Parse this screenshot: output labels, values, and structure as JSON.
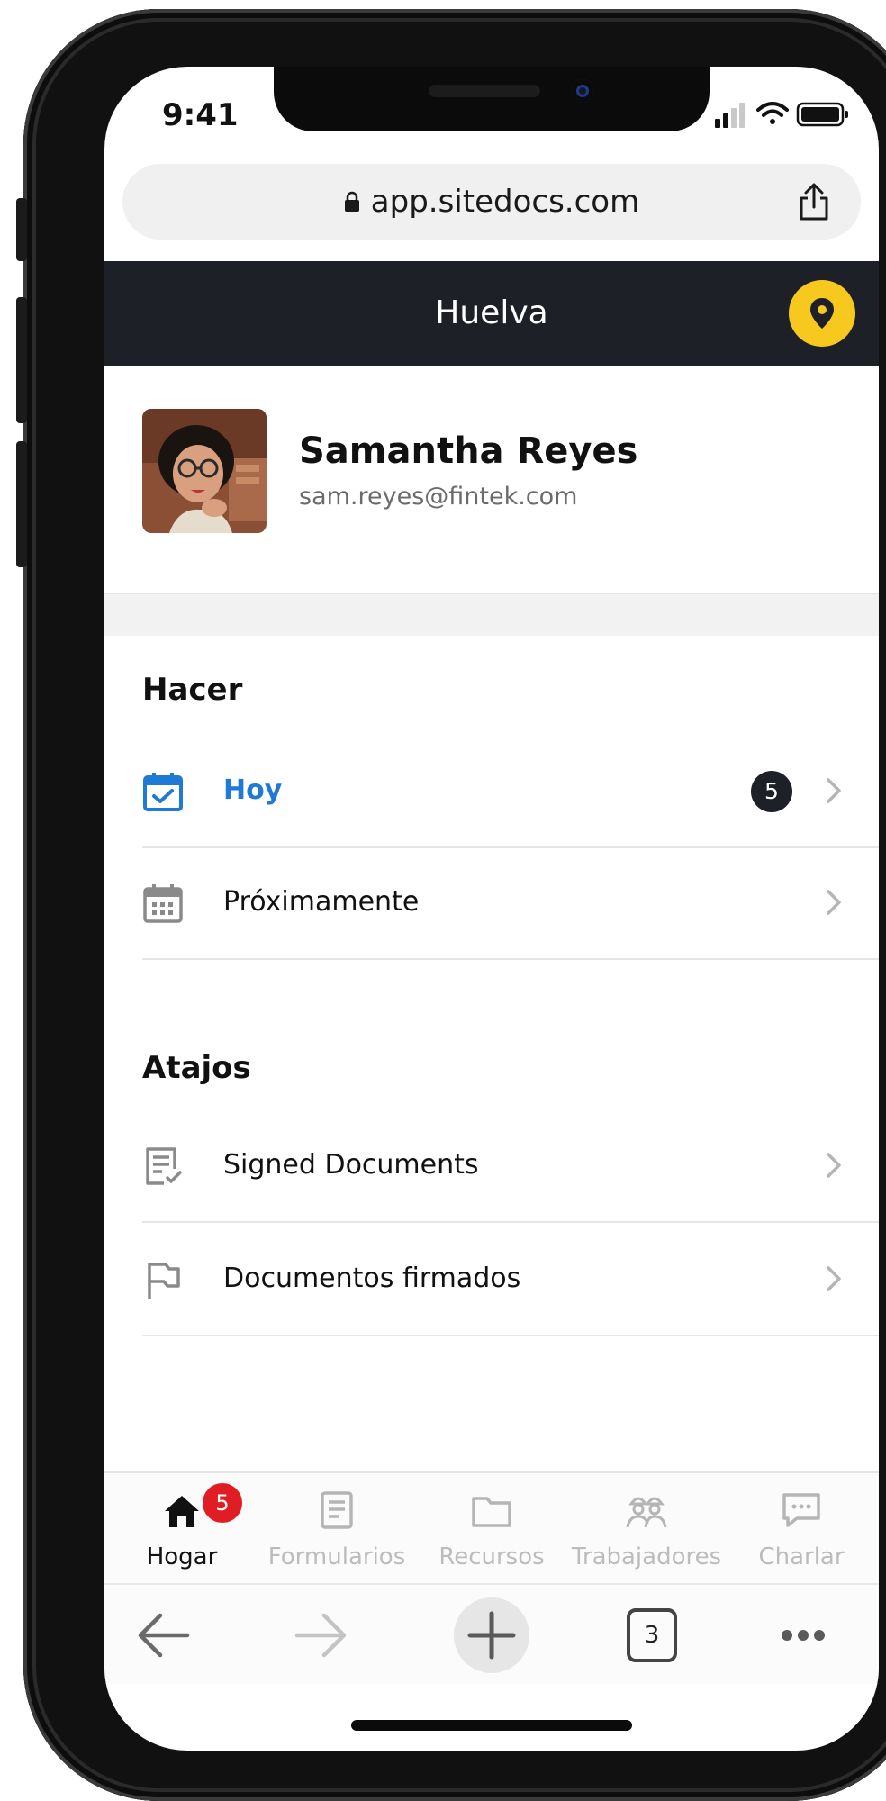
{
  "status_bar": {
    "time": "9:41"
  },
  "browser": {
    "url": "app.sitedocs.com",
    "tab_count": "3"
  },
  "header": {
    "title": "Huelva"
  },
  "profile": {
    "name": "Samantha Reyes",
    "email": "sam.reyes@fintek.com"
  },
  "sections": {
    "todo": {
      "title": "Hacer",
      "items": [
        {
          "label": "Hoy",
          "badge": "5",
          "icon": "calendar-check-icon",
          "color": "#1f7ad6"
        },
        {
          "label": "Próximamente",
          "icon": "calendar-grid-icon"
        }
      ]
    },
    "shortcuts": {
      "title": "Atajos",
      "items": [
        {
          "label": "Signed Documents",
          "icon": "signed-document-icon"
        },
        {
          "label": "Documentos firmados",
          "icon": "flag-icon"
        }
      ]
    }
  },
  "tab_bar": {
    "items": [
      {
        "label": "Hogar",
        "icon": "home-icon",
        "badge": "5",
        "active": true
      },
      {
        "label": "Formularios",
        "icon": "form-icon"
      },
      {
        "label": "Recursos",
        "icon": "folder-icon"
      },
      {
        "label": "Trabajadores",
        "icon": "workers-icon"
      },
      {
        "label": "Charlar",
        "icon": "chat-icon"
      }
    ]
  },
  "colors": {
    "header_bg": "#1e2028",
    "accent_blue": "#1f7ad6",
    "pin_yellow": "#f7c81e",
    "badge_red": "#e11d24"
  }
}
